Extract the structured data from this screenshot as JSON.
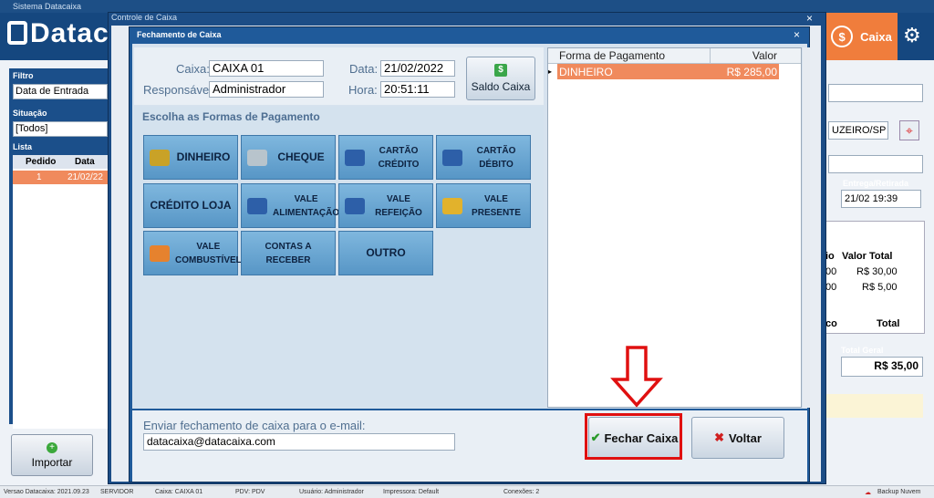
{
  "app": {
    "title": "Sistema Datacaixa",
    "logo_text": "Datac",
    "caixa_label": "Caixa",
    "caixa_symbol": "$",
    "gear_symbol": "⚙"
  },
  "left_panel": {
    "filtro_label": "Filtro",
    "filtro_value": "Data de Entrada",
    "situacao_label": "Situação",
    "situacao_value": "[Todos]",
    "lista_label": "Lista",
    "list_headers": [
      "Pedido",
      "Data"
    ],
    "list_rows": [
      [
        "1",
        "21/02/22"
      ]
    ],
    "importar_label": "Importar"
  },
  "right_panel": {
    "city": "UZEIRO/SP",
    "entrega_label": "Entrega/Retirada",
    "entrega_value": "21/02 19:39",
    "table_headers": [
      "io",
      "Valor Total"
    ],
    "table_rows": [
      [
        "00",
        "R$ 30,00"
      ],
      [
        "00",
        "R$ 5,00"
      ]
    ],
    "table_footer": [
      "co",
      "Total"
    ],
    "total_geral_label": "Total Geral",
    "total_geral_value": "R$ 35,00"
  },
  "controle_window": {
    "title": "Controle de Caixa",
    "close": "×"
  },
  "dialog": {
    "title": "Fechamento de Caixa",
    "close": "×",
    "caixa_label": "Caixa:",
    "caixa_value": "CAIXA 01",
    "responsavel_label": "Responsável:",
    "responsavel_value": "Administrador",
    "data_label": "Data:",
    "data_value": "21/02/2022",
    "hora_label": "Hora:",
    "hora_value": "20:51:11",
    "saldo_label": "Saldo Caixa",
    "saldo_icon": "$",
    "payment_title": "Escolha as Formas de Pagamento",
    "payment_buttons": [
      {
        "label": "DINHEIRO",
        "icon": "coins-icon",
        "color": "#c9a227"
      },
      {
        "label": "CHEQUE",
        "icon": "cheque-icon",
        "color": "#b8c4cc"
      },
      {
        "label": "CARTÃO CRÉDITO",
        "icon": "credit-card-icon",
        "color": "#2d5fa8"
      },
      {
        "label": "CARTÃO DÉBITO",
        "icon": "debit-card-icon",
        "color": "#2d5fa8"
      },
      {
        "label": "CRÉDITO LOJA",
        "icon": "",
        "color": ""
      },
      {
        "label": "VALE ALIMENTAÇÃO",
        "icon": "voucher-icon",
        "color": "#2d5fa8"
      },
      {
        "label": "VALE REFEIÇÃO",
        "icon": "voucher-icon",
        "color": "#2d5fa8"
      },
      {
        "label": "VALE PRESENTE",
        "icon": "gift-icon",
        "color": "#e2b22c"
      },
      {
        "label": "VALE COMBUSTÍVEL",
        "icon": "fuel-icon",
        "color": "#e6822e"
      },
      {
        "label": "CONTAS A RECEBER",
        "icon": "",
        "color": ""
      },
      {
        "label": "OUTRO",
        "icon": "",
        "color": ""
      }
    ],
    "grid_headers": [
      "Forma de Pagamento",
      "Valor"
    ],
    "grid_rows": [
      [
        "DINHEIRO",
        "R$ 285,00"
      ]
    ],
    "grid_selected_color": "#f08a5d",
    "email_label": "Enviar fechamento de caixa para o e-mail:",
    "email_value": "datacaixa@datacaixa.com",
    "fechar_label": "Fechar Caixa",
    "fechar_icon": "✔",
    "voltar_label": "Voltar",
    "voltar_icon": "✖",
    "highlight_color": "#e01010"
  },
  "statusbar": {
    "versao": "Versao Datacaixa: 2021.09.23",
    "servidor": "SERVIDOR",
    "caixa": "Caixa: CAIXA 01",
    "pdv": "PDV: PDV",
    "usuario": "Usuário: Administrador",
    "impressora": "Impressora: Default",
    "conexoes": "Conexões: 2",
    "backup": "Backup Nuvem"
  }
}
